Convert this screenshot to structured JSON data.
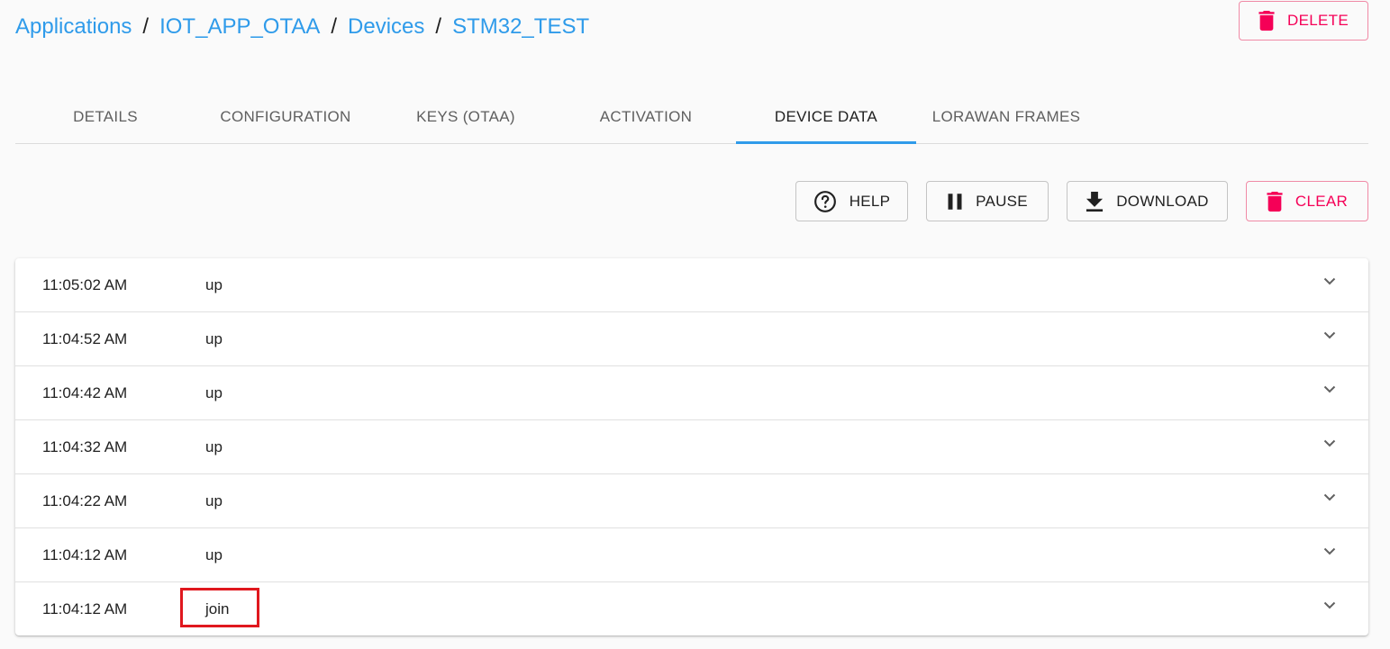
{
  "breadcrumb": {
    "items": [
      "Applications",
      "IOT_APP_OTAA",
      "Devices",
      "STM32_TEST"
    ],
    "separator": "/"
  },
  "header": {
    "delete_label": "DELETE"
  },
  "tabs": [
    {
      "label": "DETAILS",
      "active": false
    },
    {
      "label": "CONFIGURATION",
      "active": false
    },
    {
      "label": "KEYS (OTAA)",
      "active": false
    },
    {
      "label": "ACTIVATION",
      "active": false
    },
    {
      "label": "DEVICE DATA",
      "active": true
    },
    {
      "label": "LORAWAN FRAMES",
      "active": false
    }
  ],
  "toolbar": {
    "help_label": "HELP",
    "pause_label": "PAUSE",
    "download_label": "DOWNLOAD",
    "clear_label": "CLEAR"
  },
  "events": [
    {
      "time": "11:05:02 AM",
      "type": "up"
    },
    {
      "time": "11:04:52 AM",
      "type": "up"
    },
    {
      "time": "11:04:42 AM",
      "type": "up"
    },
    {
      "time": "11:04:32 AM",
      "type": "up"
    },
    {
      "time": "11:04:22 AM",
      "type": "up"
    },
    {
      "time": "11:04:12 AM",
      "type": "up"
    },
    {
      "time": "11:04:12 AM",
      "type": "join",
      "highlighted": true
    }
  ],
  "colors": {
    "link": "#2f9bea",
    "danger": "#f50057",
    "highlight": "#e0181e",
    "tab_indicator": "#2f9bea"
  },
  "icons": {
    "delete": "trash-icon",
    "help": "help-circle-icon",
    "pause": "pause-icon",
    "download": "download-icon",
    "clear": "trash-icon",
    "expand": "chevron-down-icon"
  }
}
